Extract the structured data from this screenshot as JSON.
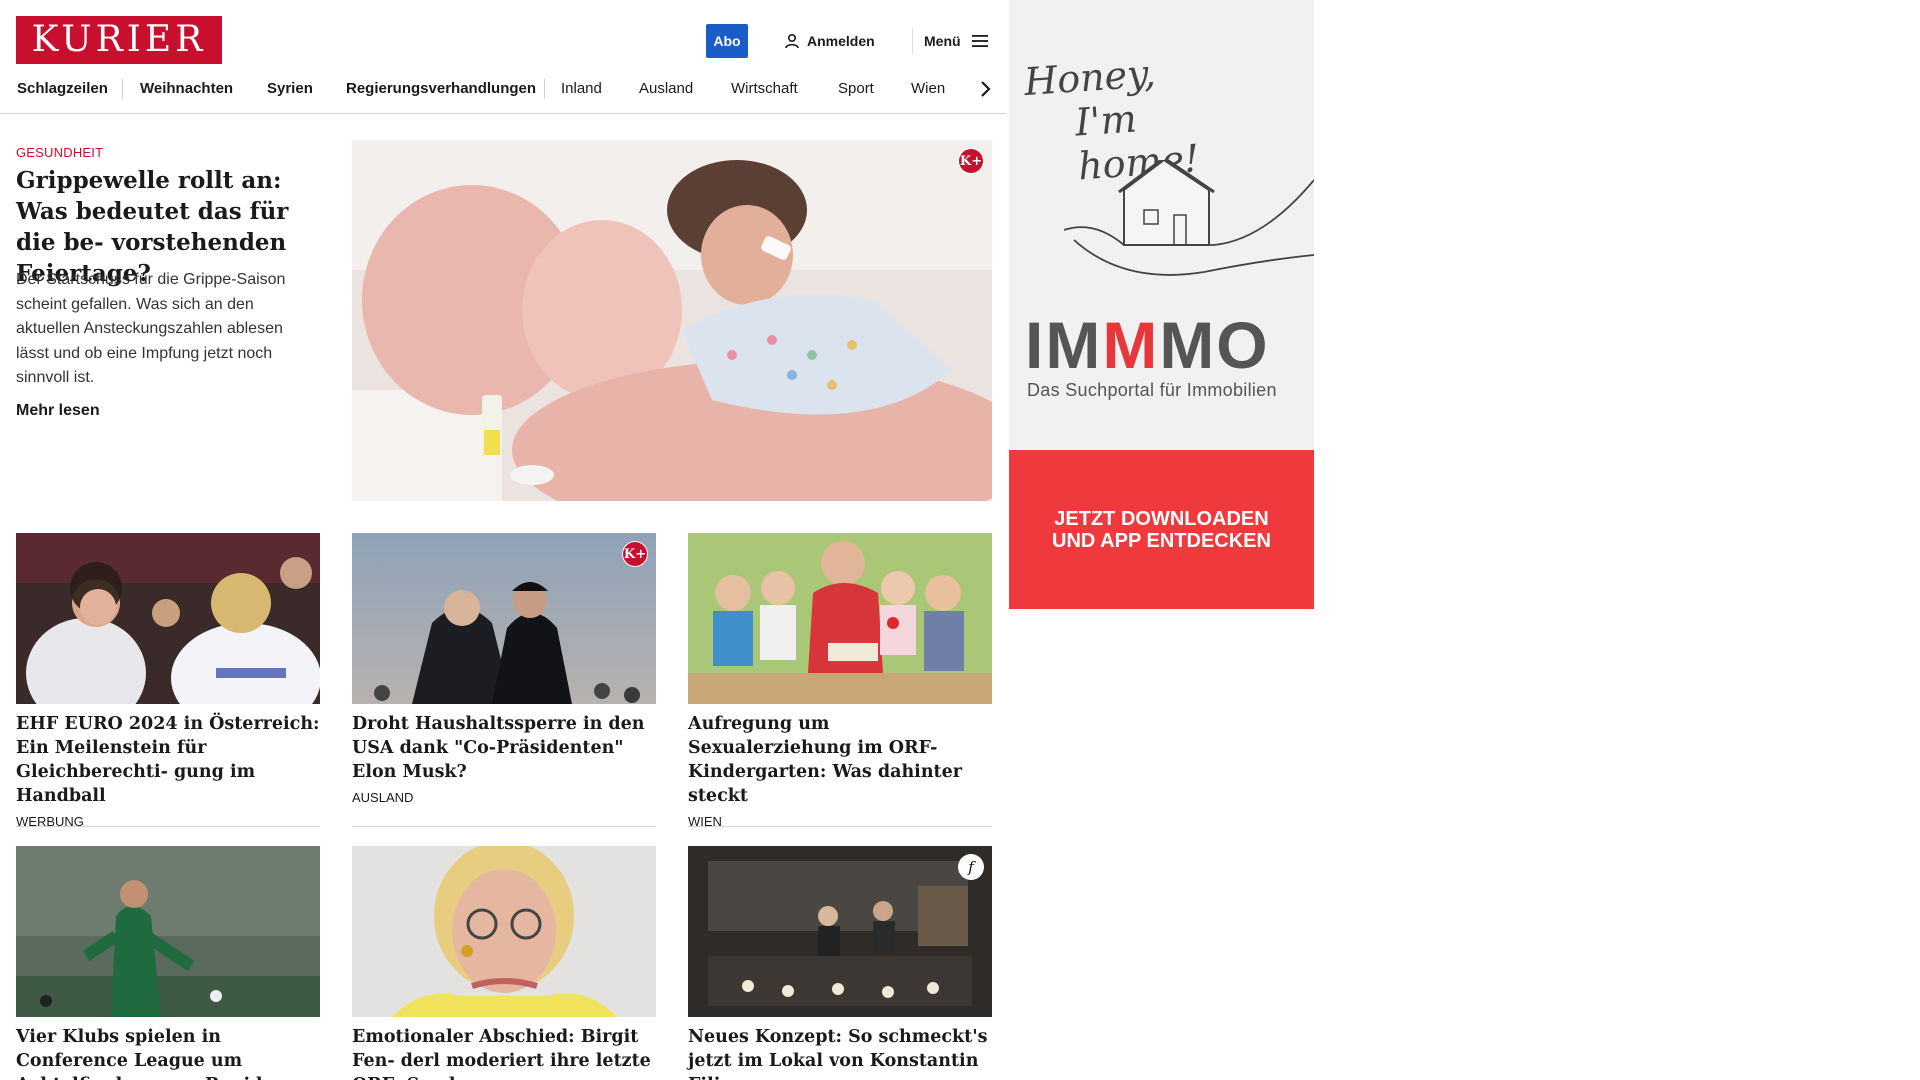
{
  "header": {
    "logo_text": "KURIER",
    "abo_label": "Abo",
    "login_label": "Anmelden",
    "menu_label": "Menü"
  },
  "nav": {
    "items": [
      "Schlagzeilen",
      "Weihnachten",
      "Syrien",
      "Regierungsverhandlungen",
      "Inland",
      "Ausland",
      "Wirtschaft",
      "Sport",
      "Wien"
    ]
  },
  "lead": {
    "category": "GESUNDHEIT",
    "title": "Grippewelle rollt an: Was bedeutet das für die be- vorstehenden Feiertage?",
    "teaser": "Der Startschuss für die Grippe-Saison scheint gefallen. Was sich an den aktuellen Ansteckungszahlen ablesen lässt und ob eine Impfung jetzt noch sinnvoll ist.",
    "more_label": "Mehr lesen",
    "badge": "K+"
  },
  "stories": [
    {
      "title": "EHF EURO 2024 in Österreich: Ein Meilenstein für Gleichberechti- gung im Handball",
      "category": "WERBUNG",
      "badge": ""
    },
    {
      "title": "Droht Haushaltssperre in den USA dank \"Co-Präsidenten\" Elon Musk?",
      "category": "AUSLAND",
      "badge": "K+"
    },
    {
      "title": "Aufregung um Sexualerziehung im ORF-Kindergarten: Was dahinter steckt",
      "category": "WIEN",
      "badge": ""
    },
    {
      "title": "Vier Klubs spielen in Conference League um Achtelfinale gegen Rapid",
      "category": "",
      "badge": ""
    },
    {
      "title": "Emotionaler Abschied: Birgit Fen- derl moderiert ihre letzte ORF- Sendung",
      "category": "",
      "badge": ""
    },
    {
      "title": "Neues Konzept: So schmeckt's jetzt im Lokal von Konstantin Filippou",
      "category": "",
      "badge": "f"
    }
  ],
  "ad": {
    "script_line1": "Honey,",
    "script_line2": "I'm home!",
    "brand_part1": "IM",
    "brand_part2": "M",
    "brand_part3": "MO",
    "tagline": "Das Suchportal für Immobilien",
    "cta_line1": "JETZT DOWNLOADEN",
    "cta_line2": "UND APP ENTDECKEN"
  },
  "colors": {
    "brand_red": "#c8102e",
    "abo_blue": "#1a5dc9",
    "ad_red": "#f0393d"
  }
}
